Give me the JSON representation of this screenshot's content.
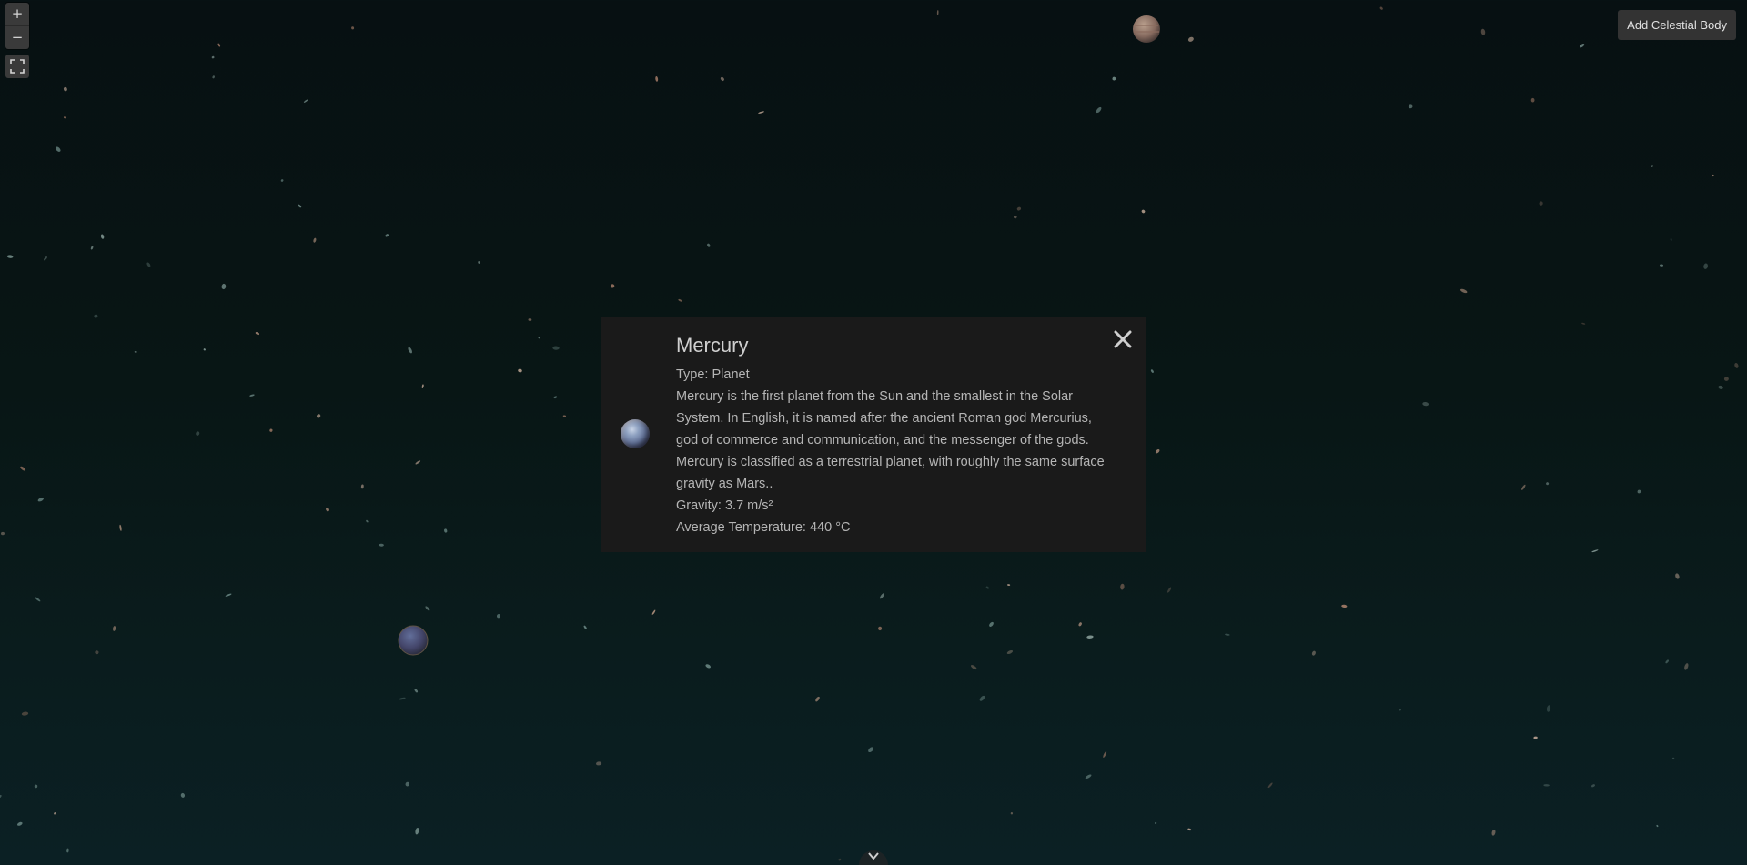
{
  "controls": {
    "zoom_in_label": "+",
    "zoom_out_label": "−",
    "fullscreen_icon": "fullscreen-icon",
    "add_button_label": "Add Celestial Body"
  },
  "info_panel": {
    "name": "Mercury",
    "type_line": "Type: Planet",
    "description": "Mercury is the first planet from the Sun and the smallest in the Solar System. In English, it is named after the ancient Roman god Mercurius, god of commerce and communication, and the messenger of the gods. Mercury is classified as a terrestrial planet, with roughly the same surface gravity as Mars..",
    "gravity_line": "Gravity: 3.7 m/s²",
    "temperature_line": "Average Temperature: 440 °C",
    "close_icon": "close-icon",
    "thumbnail": "mercury-thumbnail"
  },
  "bottom_toggle_icon": "chevron-down-icon",
  "colors": {
    "background_top": "#071012",
    "background_bottom": "#0b2024",
    "panel_bg": "#1a1a1a",
    "panel_text": "#b5b5b5",
    "button_bg": "#333333",
    "button_text": "#e2e2e2"
  }
}
